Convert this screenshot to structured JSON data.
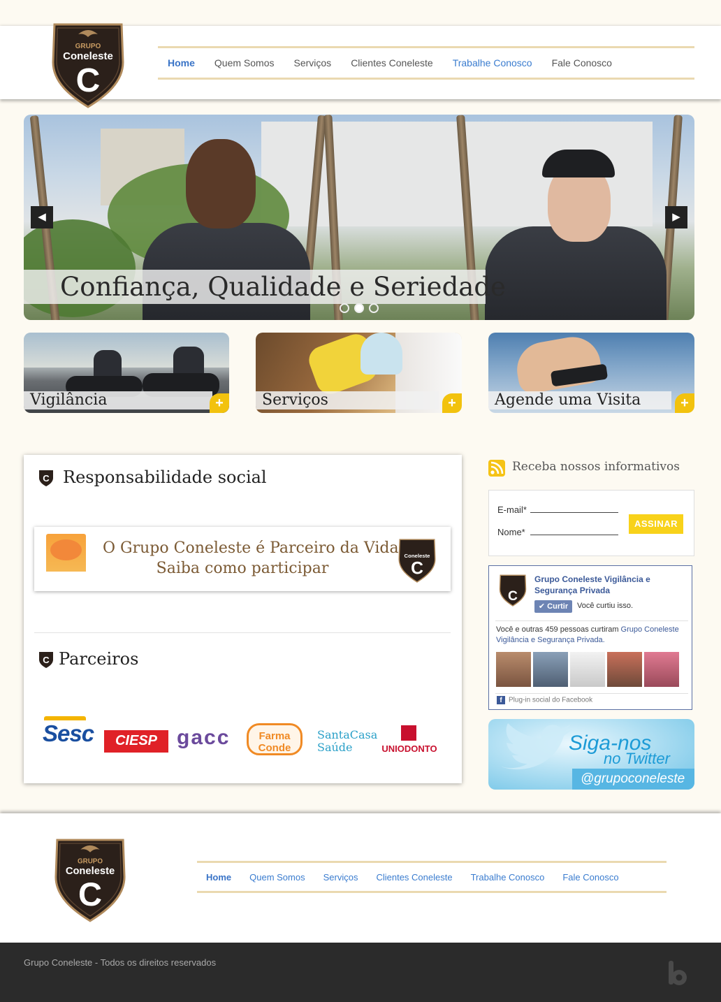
{
  "brand": {
    "logo_top": "GRUPO",
    "logo_name": "Coneleste",
    "logo_letter": "C"
  },
  "header": {
    "nav": [
      {
        "label": "Home"
      },
      {
        "label": "Quem Somos"
      },
      {
        "label": "Serviços"
      },
      {
        "label": "Clientes Coneleste"
      },
      {
        "label": "Trabalhe Conosco"
      },
      {
        "label": "Fale Conosco"
      }
    ]
  },
  "hero": {
    "caption": "Confiança, Qualidade e Seriedade",
    "prev_icon": "chevron-left-icon",
    "next_icon": "chevron-right-icon",
    "slide_count": 3,
    "active_slide": 2
  },
  "features": [
    {
      "label": "Vigilância"
    },
    {
      "label": "Serviços"
    },
    {
      "label": "Agende uma Visita"
    }
  ],
  "social": {
    "title": "Responsabilidade social",
    "banner_line1": "O Grupo Coneleste é Parceiro da Vida",
    "banner_line2": "Saiba como participar"
  },
  "partners": {
    "title": "Parceiros",
    "logos": [
      "Sesc",
      "CIESP",
      "gacc",
      "Farma Conde",
      "SantaCasa Saúde",
      "UNIODONTO"
    ]
  },
  "newsletter": {
    "title": "Receba nossos informativos",
    "email_label": "E-mail*",
    "name_label": "Nome*",
    "button": "ASSINAR"
  },
  "facebook": {
    "page_name": "Grupo Coneleste Vigilância e Segurança Privada",
    "like_button": "Curtir",
    "liked_text": "Você curtiu isso.",
    "count_text_prefix": "Você e outras 459 pessoas curtiram",
    "count_link": "Grupo Coneleste Vigilância e Segurança Privada.",
    "footer": "Plug-in social do Facebook"
  },
  "twitter": {
    "line1": "Siga-nos",
    "line2": "no Twitter",
    "handle": "@grupoconeleste"
  },
  "footer": {
    "nav": [
      {
        "label": "Home"
      },
      {
        "label": "Quem Somos"
      },
      {
        "label": "Serviços"
      },
      {
        "label": "Clientes Coneleste"
      },
      {
        "label": "Trabalhe Conosco"
      },
      {
        "label": "Fale Conosco"
      }
    ],
    "copyright": "Grupo Coneleste - Todos os direitos reservados"
  }
}
